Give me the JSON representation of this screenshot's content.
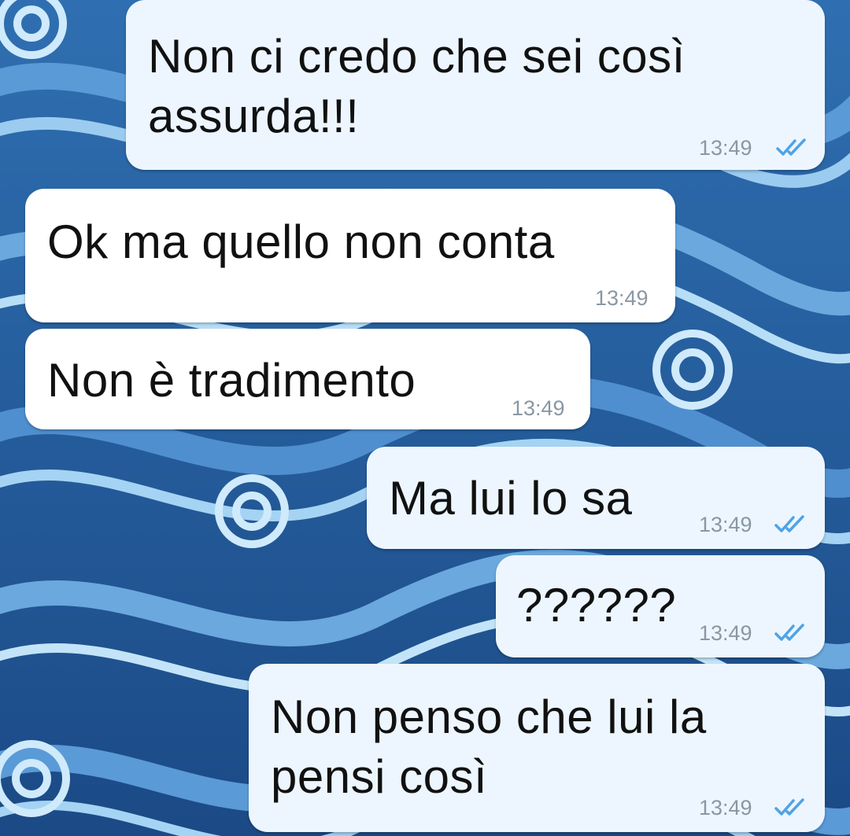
{
  "conversation": {
    "messages": [
      {
        "direction": "outgoing",
        "text": "Non ci credo che sei così\nassurda!!!",
        "time": "13:49",
        "status": "read"
      },
      {
        "direction": "incoming",
        "text": "Ok ma quello non conta",
        "time": "13:49"
      },
      {
        "direction": "incoming",
        "text": "Non è tradimento",
        "time": "13:49"
      },
      {
        "direction": "outgoing",
        "text": "Ma lui lo sa",
        "time": "13:49",
        "status": "read"
      },
      {
        "direction": "outgoing",
        "text": "??????",
        "time": "13:49",
        "status": "read"
      },
      {
        "direction": "outgoing",
        "text": "Non penso che lui la\npensi così",
        "time": "13:49",
        "status": "read"
      }
    ]
  },
  "colors": {
    "outgoing_bubble": "#edf6ff",
    "incoming_bubble": "#ffffff",
    "read_ticks": "#4fa3e6",
    "timestamp": "#8a97a3",
    "wallpaper_dark": "#1d4f8c",
    "wallpaper_light": "#8fc6ee"
  },
  "icons": {
    "read_status": "double-check-icon"
  }
}
